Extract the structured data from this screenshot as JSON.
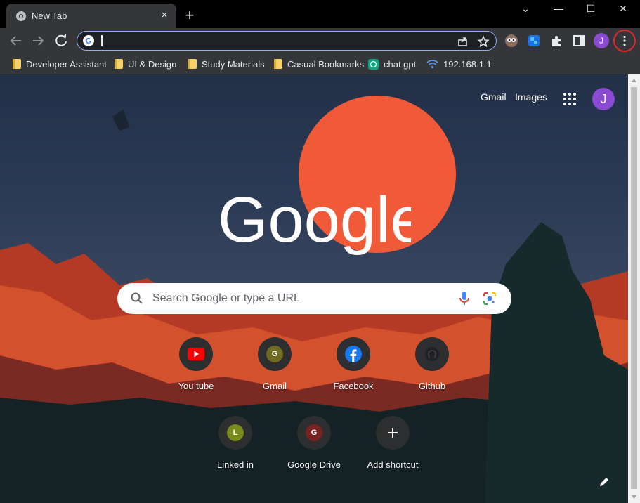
{
  "window": {
    "tab_title": "New Tab",
    "tab_close": "×",
    "new_tab": "+",
    "controls": {
      "tab_search": "⌄",
      "minimize": "—",
      "maximize": "☐",
      "close": "✕"
    }
  },
  "toolbar": {
    "url_value": "",
    "profile_initial": "J"
  },
  "bookmarks": [
    {
      "label": "Developer Assistant",
      "icon": "folder-icon"
    },
    {
      "label": "UI & Design",
      "icon": "folder-icon"
    },
    {
      "label": "Study Materials",
      "icon": "folder-icon"
    },
    {
      "label": "Casual Bookmarks",
      "icon": "folder-icon"
    },
    {
      "label": "chat gpt",
      "icon": "chatgpt-icon"
    },
    {
      "label": "192.168.1.1",
      "icon": "wifi-icon"
    }
  ],
  "page": {
    "top_links": {
      "gmail": "Gmail",
      "images": "Images"
    },
    "account_initial": "J",
    "search_placeholder": "Search Google or type a URL",
    "shortcuts": [
      {
        "label": "You tube",
        "icon": "youtube-icon"
      },
      {
        "label": "Gmail",
        "letter": "G",
        "color": "#6f6a1e"
      },
      {
        "label": "Facebook",
        "icon": "facebook-icon"
      },
      {
        "label": "Github",
        "icon": "github-icon"
      },
      {
        "label": "Linked in",
        "letter": "L",
        "color": "#7a8a1c"
      },
      {
        "label": "Google Drive",
        "letter": "G",
        "color": "#7a2222"
      },
      {
        "label": "Add shortcut",
        "icon": "plus-icon"
      }
    ]
  },
  "colors": {
    "accent_focus": "#8ab4f8",
    "sun": "#f05a38",
    "avatar": "#8a4ad1",
    "highlight_circle": "#e3262c"
  }
}
